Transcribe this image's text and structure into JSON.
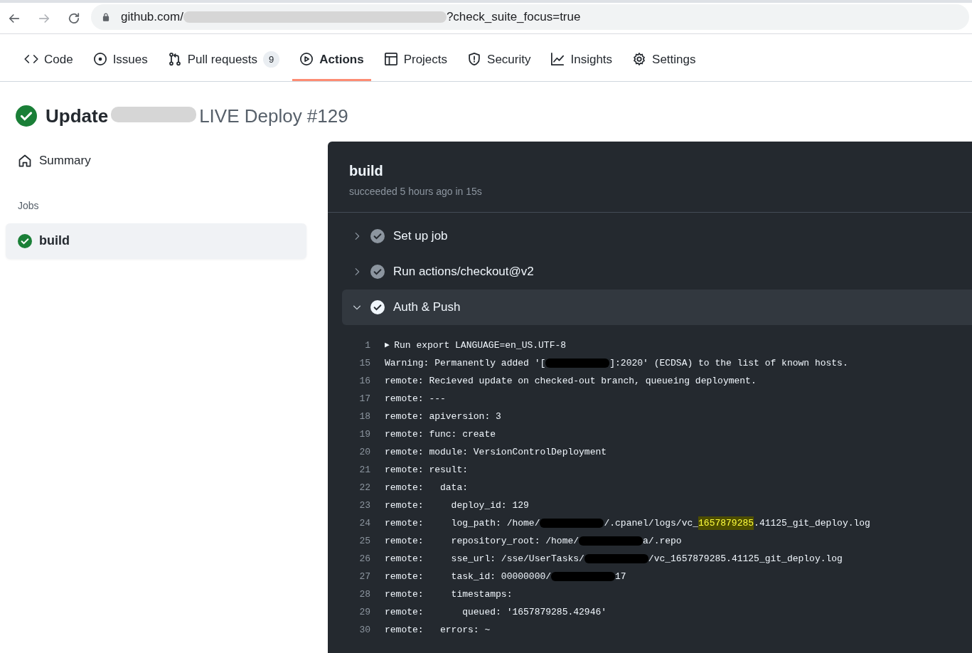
{
  "browser": {
    "buttons": [
      {
        "kind": "back",
        "disabled": false
      },
      {
        "kind": "forward",
        "disabled": true
      },
      {
        "kind": "reload",
        "disabled": false
      }
    ],
    "url": [
      {
        "kind": "text",
        "text": "github.com/"
      },
      {
        "kind": "redacted"
      },
      {
        "kind": "text",
        "text": "?check_suite_focus=true"
      }
    ]
  },
  "repo_tabs": [
    {
      "kind": "code",
      "label": "Code",
      "selected": false
    },
    {
      "kind": "issue",
      "label": "Issues",
      "selected": false
    },
    {
      "kind": "pull",
      "label": "Pull requests",
      "counter": "9",
      "selected": false
    },
    {
      "kind": "play",
      "label": "Actions",
      "selected": true
    },
    {
      "kind": "table",
      "label": "Projects",
      "selected": false
    },
    {
      "kind": "shield",
      "label": "Security",
      "selected": false
    },
    {
      "kind": "graph",
      "label": "Insights",
      "selected": false
    },
    {
      "kind": "gear",
      "label": "Settings",
      "selected": false
    }
  ],
  "run_title": {
    "parts": [
      {
        "kind": "strong",
        "text": "Update"
      },
      {
        "kind": "redacted"
      },
      {
        "kind": "text",
        "text": "LIVE Deploy #129"
      }
    ]
  },
  "sidebar": {
    "summary": "Summary",
    "jobs_heading": "Jobs",
    "jobs": [
      {
        "label": "build",
        "selected": true
      }
    ]
  },
  "job": {
    "title": "build",
    "subtitle": "succeeded 5 hours ago in 15s",
    "steps": [
      {
        "label": "Set up job",
        "expanded": false
      },
      {
        "label": "Run actions/checkout@v2",
        "expanded": false
      },
      {
        "label": "Auth & Push",
        "expanded": true
      }
    ],
    "log": [
      {
        "number": "1",
        "toggle": "▶",
        "segments": [
          {
            "kind": "text",
            "text": "Run export LANGUAGE=en_US.UTF-8"
          }
        ]
      },
      {
        "number": "15",
        "segments": [
          {
            "kind": "text",
            "text": "Warning: Permanently added '["
          },
          {
            "kind": "redacted"
          },
          {
            "kind": "text",
            "text": "]:2020' (ECDSA) to the list of known hosts."
          }
        ]
      },
      {
        "number": "16",
        "segments": [
          {
            "kind": "text",
            "text": "remote: Recieved update on checked-out branch, queueing deployment."
          }
        ]
      },
      {
        "number": "17",
        "segments": [
          {
            "kind": "text",
            "text": "remote: ---"
          }
        ]
      },
      {
        "number": "18",
        "segments": [
          {
            "kind": "text",
            "text": "remote: apiversion: 3"
          }
        ]
      },
      {
        "number": "19",
        "segments": [
          {
            "kind": "text",
            "text": "remote: func: create"
          }
        ]
      },
      {
        "number": "20",
        "segments": [
          {
            "kind": "text",
            "text": "remote: module: VersionControlDeployment"
          }
        ]
      },
      {
        "number": "21",
        "segments": [
          {
            "kind": "text",
            "text": "remote: result:"
          }
        ]
      },
      {
        "number": "22",
        "segments": [
          {
            "kind": "text",
            "text": "remote:   data:"
          }
        ]
      },
      {
        "number": "23",
        "segments": [
          {
            "kind": "text",
            "text": "remote:     deploy_id: 129"
          }
        ]
      },
      {
        "number": "24",
        "segments": [
          {
            "kind": "text",
            "text": "remote:     log_path: /home/"
          },
          {
            "kind": "redacted"
          },
          {
            "kind": "text",
            "text": "/.cpanel/logs/vc_"
          },
          {
            "kind": "highlight",
            "text": "1657879285"
          },
          {
            "kind": "text",
            "text": ".41125_git_deploy.log"
          }
        ]
      },
      {
        "number": "25",
        "segments": [
          {
            "kind": "text",
            "text": "remote:     repository_root: /home/"
          },
          {
            "kind": "redacted"
          },
          {
            "kind": "text",
            "text": "a/.repo"
          }
        ]
      },
      {
        "number": "26",
        "segments": [
          {
            "kind": "text",
            "text": "remote:     sse_url: /sse/UserTasks/"
          },
          {
            "kind": "redacted"
          },
          {
            "kind": "text",
            "text": "/vc_1657879285.41125_git_deploy.log"
          }
        ]
      },
      {
        "number": "27",
        "segments": [
          {
            "kind": "text",
            "text": "remote:     task_id: 00000000/"
          },
          {
            "kind": "redacted"
          },
          {
            "kind": "text",
            "text": "17"
          }
        ]
      },
      {
        "number": "28",
        "segments": [
          {
            "kind": "text",
            "text": "remote:     timestamps:"
          }
        ]
      },
      {
        "number": "29",
        "segments": [
          {
            "kind": "text",
            "text": "remote:       queued: '1657879285.42946'"
          }
        ]
      },
      {
        "number": "30",
        "segments": [
          {
            "kind": "text",
            "text": "remote:   errors: ~"
          }
        ]
      }
    ]
  }
}
